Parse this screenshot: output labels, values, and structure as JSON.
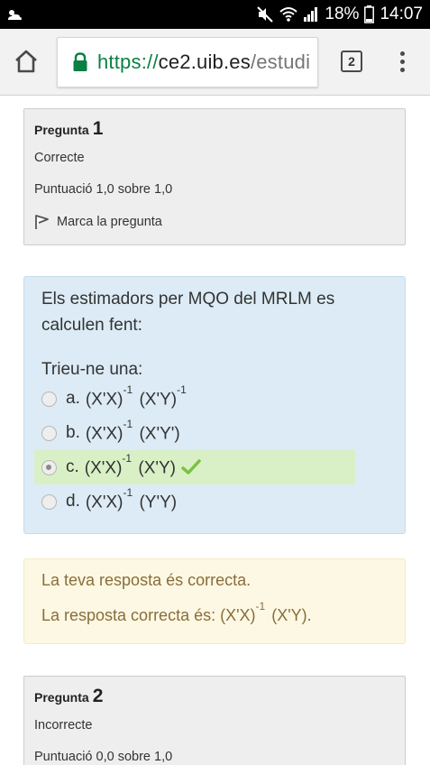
{
  "status_bar": {
    "battery": "18%",
    "time": "14:07",
    "icons": [
      "weather-cloud-sun-icon",
      "mute-icon",
      "wifi-icon",
      "signal-icon",
      "battery-icon"
    ]
  },
  "browser": {
    "url_scheme": "https://",
    "url_host": "ce2.uib.es",
    "url_rest": "/estudi",
    "tab_count": "2",
    "secure_color": "#0b8043"
  },
  "question1": {
    "label": "Pregunta",
    "number": "1",
    "state": "Correcte",
    "grade": "Puntuació 1,0 sobre 1,0",
    "flag_text": "Marca la pregunta",
    "text": "Els estimadors per MQO del MRLM es calculen fent:",
    "prompt": "Trieu-ne una:",
    "answers": [
      {
        "letter": "a.",
        "p1": "(X'X)",
        "e1": "-1",
        "p2": "(X'Y)",
        "e2": "-1",
        "selected": false
      },
      {
        "letter": "b.",
        "p1": "(X'X)",
        "e1": "-1",
        "p2": "(X'Y')",
        "e2": "",
        "selected": false
      },
      {
        "letter": "c.",
        "p1": "(X'X)",
        "e1": "-1",
        "p2": "(X'Y)",
        "e2": "",
        "selected": true
      },
      {
        "letter": "d.",
        "p1": "(X'X)",
        "e1": "-1",
        "p2": "(Y'Y)",
        "e2": "",
        "selected": false
      }
    ],
    "feedback_correct": "La teva resposta és correcta.",
    "feedback_answer_prefix": "La resposta correcta és: (X'X)",
    "feedback_answer_exp": "-1",
    "feedback_answer_suffix": " (X'Y).",
    "colors": {
      "info_bg": "#eeeeee",
      "formulation_bg": "#dcebf5",
      "selected_bg": "#d9f0c6",
      "feedback_bg": "#fcf8e3",
      "feedback_text": "#8a6d3b",
      "check": "#7cc142"
    }
  },
  "question2": {
    "label": "Pregunta",
    "number": "2",
    "state": "Incorrecte",
    "grade": "Puntuació 0,0 sobre 1,0"
  }
}
